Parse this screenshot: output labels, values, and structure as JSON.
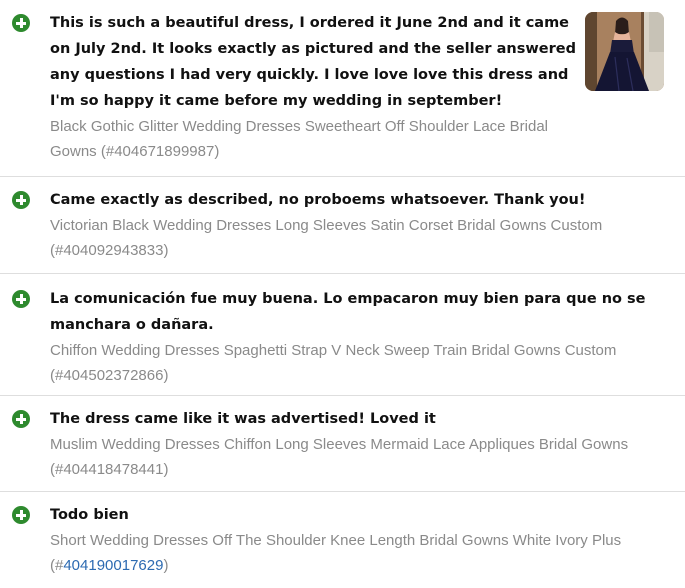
{
  "reviews": [
    {
      "comment": "This is such a beautiful dress, I ordered it June 2nd and it came on July 2nd. It looks exactly as pictured and the seller answered any questions I had very quickly. I love love love this dress and I'm so happy it came before my wedding in september!",
      "product": "Black Gothic Glitter Wedding Dresses Sweetheart Off Shoulder Lace Bridal Gowns",
      "item_number_prefix": "(#",
      "item_number": "404671899987",
      "item_number_suffix": ")",
      "has_photo": true
    },
    {
      "comment": "Came exactly as described, no proboems whatsoever. Thank you!",
      "product": "Victorian Black Wedding Dresses Long Sleeves Satin Corset Bridal Gowns Custom",
      "item_number_prefix": "(#",
      "item_number": "404092943833",
      "item_number_suffix": ")"
    },
    {
      "comment": "La comunicación fue muy buena. Lo empacaron muy bien para que no se manchara o dañara.",
      "product": "Chiffon Wedding Dresses Spaghetti Strap V Neck Sweep Train Bridal Gowns Custom",
      "item_number_prefix": "(#",
      "item_number": "404502372866",
      "item_number_suffix": ")"
    },
    {
      "comment": "The dress came like it was advertised! Loved it",
      "product": "Muslim Wedding Dresses Chiffon Long Sleeves Mermaid Lace Appliques Bridal Gowns",
      "item_number_prefix": "(#",
      "item_number": "404418478441",
      "item_number_suffix": ")"
    },
    {
      "comment": "Todo bien",
      "product": "Short Wedding Dresses Off The Shoulder Knee Length Bridal Gowns White Ivory Plus",
      "item_number_prefix": "(#",
      "item_number": "404190017629",
      "item_number_suffix": ")",
      "item_number_is_link": true
    }
  ],
  "colors": {
    "positive_icon": "#2e8a2e",
    "comment_text": "#111111",
    "product_text": "#8a8a8a",
    "link": "#2c6ab1",
    "divider": "#dedede"
  },
  "icons": {
    "rating": "positive-feedback-plus-icon"
  }
}
